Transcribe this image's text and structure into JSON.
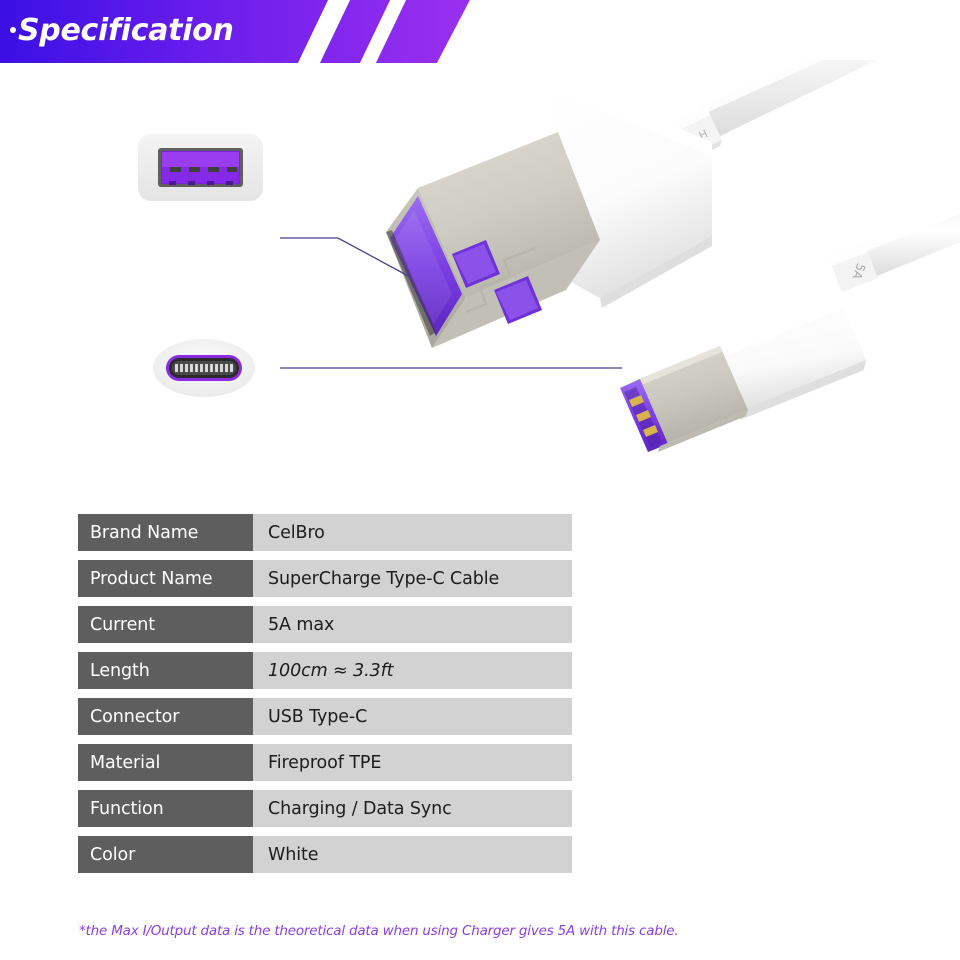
{
  "header": {
    "title": "Specification",
    "bullet_icon": "dot-icon",
    "gradient_start": "#3a10e5",
    "gradient_end": "#9b30ef",
    "stripe_color": "#ffffff"
  },
  "product_image": {
    "alt": "SuperCharge Type-C cable with USB-A and USB-C connectors",
    "cable_color": "#ffffff",
    "metal_color": "#cfccc4",
    "accent_color": "#7b3fe4",
    "usba_marking": "H",
    "usbc_marking": "5A",
    "leader_line_color": "#4b3f8f"
  },
  "callouts": [
    {
      "name": "usb-a-port",
      "label": "USB Type-A port",
      "port_color": "#8a2be2",
      "frame_color": "#6f6f6f",
      "box_color": "#eeeeee"
    },
    {
      "name": "usb-c-port",
      "label": "USB Type-C port",
      "port_color": "#8a2be2",
      "frame_color": "#2b2b2b",
      "box_color": "#f1f1f1"
    }
  ],
  "spec_table": {
    "label_bg": "#5e5e5e",
    "value_bg": "#d2d2d2",
    "rows": [
      {
        "label": "Brand Name",
        "value": "CelBro",
        "italic": false
      },
      {
        "label": "Product Name",
        "value": "SuperCharge Type-C Cable",
        "italic": false
      },
      {
        "label": "Current",
        "value": "5A max",
        "italic": false
      },
      {
        "label": "Length",
        "value": "100cm ≈ 3.3ft",
        "italic": true
      },
      {
        "label": "Connector",
        "value": "USB Type-C",
        "italic": false
      },
      {
        "label": "Material",
        "value": "Fireproof TPE",
        "italic": false
      },
      {
        "label": "Function",
        "value": "Charging / Data Sync",
        "italic": false
      },
      {
        "label": "Color",
        "value": "White",
        "italic": false
      }
    ]
  },
  "footnote": {
    "text": "*the Max I/Output data is the theoretical data when using Charger gives 5A with this cable.",
    "color": "#8b3fe0"
  }
}
